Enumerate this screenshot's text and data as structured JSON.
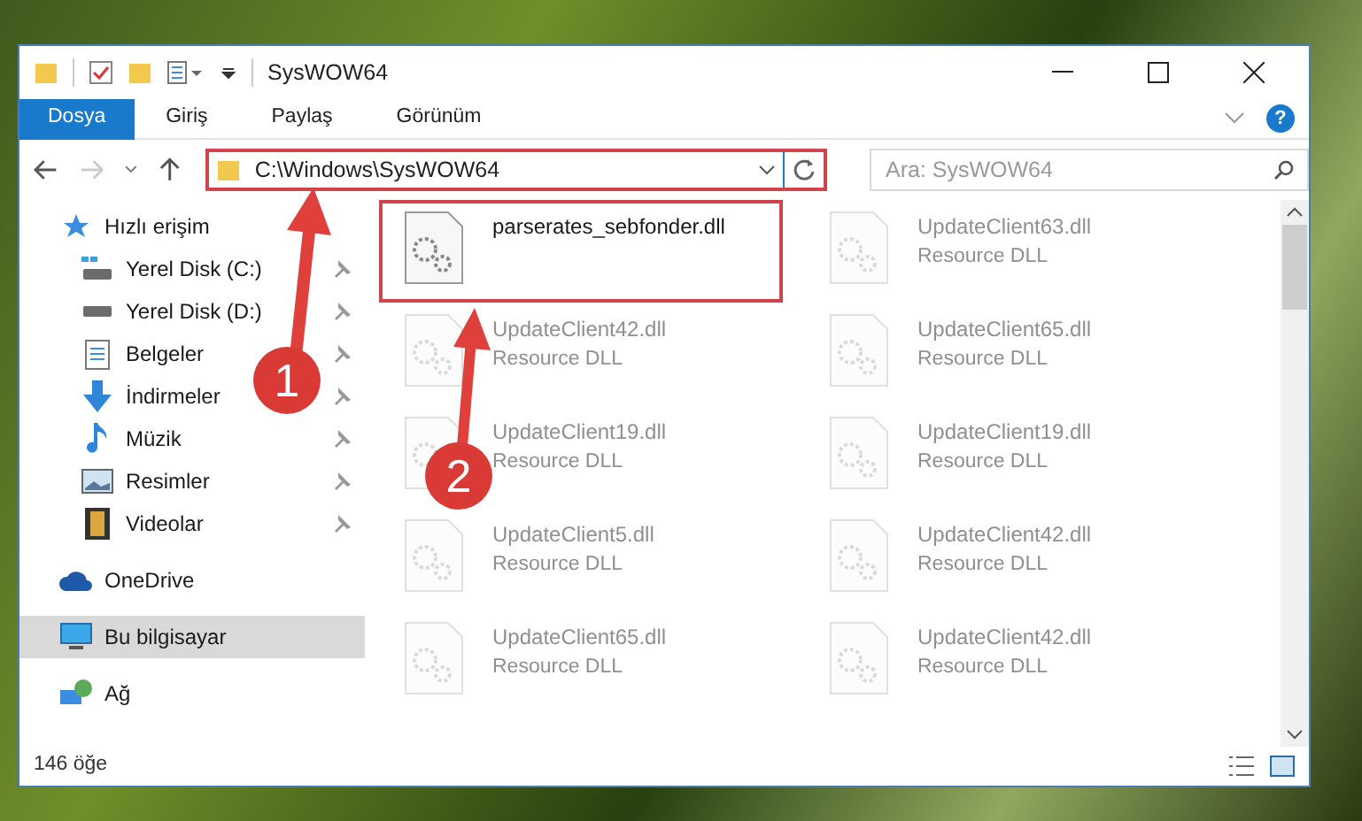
{
  "window": {
    "title": "SysWOW64"
  },
  "ribbon": {
    "tabs": [
      {
        "label": "Dosya",
        "selected": true
      },
      {
        "label": "Giriş",
        "selected": false
      },
      {
        "label": "Paylaş",
        "selected": false
      },
      {
        "label": "Görünüm",
        "selected": false
      }
    ],
    "help": "?"
  },
  "address": {
    "path": "C:\\Windows\\SysWOW64",
    "search_placeholder": "Ara: SysWOW64"
  },
  "sidebar": {
    "items": [
      {
        "label": "Hızlı erişim",
        "kind": "star",
        "pinned": false,
        "selected": false,
        "children": [
          {
            "label": "Yerel Disk (C:)",
            "kind": "drive-c",
            "pinned": true,
            "selected": false
          },
          {
            "label": "Yerel Disk (D:)",
            "kind": "drive",
            "pinned": true,
            "selected": false
          },
          {
            "label": "Belgeler",
            "kind": "docs",
            "pinned": true,
            "selected": false
          },
          {
            "label": "İndirmeler",
            "kind": "download",
            "pinned": true,
            "selected": false
          },
          {
            "label": "Müzik",
            "kind": "music",
            "pinned": true,
            "selected": false
          },
          {
            "label": "Resimler",
            "kind": "pictures",
            "pinned": true,
            "selected": false
          },
          {
            "label": "Videolar",
            "kind": "videos",
            "pinned": true,
            "selected": false
          }
        ]
      },
      {
        "label": "OneDrive",
        "kind": "cloud",
        "pinned": false,
        "selected": false
      },
      {
        "label": "Bu bilgisayar",
        "kind": "pc",
        "pinned": false,
        "selected": true
      },
      {
        "label": "Ağ",
        "kind": "network",
        "pinned": false,
        "selected": false
      }
    ]
  },
  "files": [
    {
      "name": "parserates_sebfonder.dll",
      "faded": false
    },
    {
      "name": "UpdateClient63.dll",
      "type": "Resource DLL",
      "faded": true
    },
    {
      "name": "UpdateClient42.dll",
      "type": "Resource DLL",
      "faded": true
    },
    {
      "name": "UpdateClient65.dll",
      "type": "Resource DLL",
      "faded": true
    },
    {
      "name": "UpdateClient19.dll",
      "type": "Resource DLL",
      "faded": true
    },
    {
      "name": "UpdateClient19.dll",
      "type": "Resource DLL",
      "faded": true
    },
    {
      "name": "UpdateClient5.dll",
      "type": "Resource DLL",
      "faded": true
    },
    {
      "name": "UpdateClient42.dll",
      "type": "Resource DLL",
      "faded": true
    },
    {
      "name": "UpdateClient65.dll",
      "type": "Resource DLL",
      "faded": true
    },
    {
      "name": "UpdateClient42.dll",
      "type": "Resource DLL",
      "faded": true
    }
  ],
  "status_bar": {
    "count": "146 öğe"
  },
  "annotations": [
    {
      "number": "1"
    },
    {
      "number": "2"
    }
  ]
}
